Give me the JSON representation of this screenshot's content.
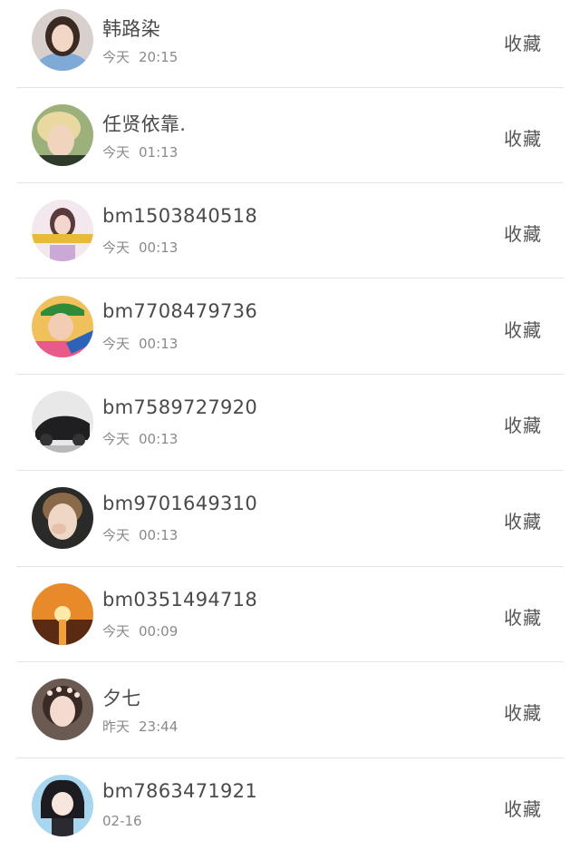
{
  "contacts": [
    {
      "name": "韩路染",
      "day": "今天",
      "time": "20:15",
      "action": "收藏",
      "avatar": "avatar-girl-blue-top"
    },
    {
      "name": "任贤依靠.",
      "day": "今天",
      "time": "01:13",
      "action": "收藏",
      "avatar": "avatar-blonde-boy"
    },
    {
      "name": "bm1503840518",
      "day": "今天",
      "time": "00:13",
      "action": "收藏",
      "avatar": "avatar-girl-banner"
    },
    {
      "name": "bm7708479736",
      "day": "今天",
      "time": "00:13",
      "action": "收藏",
      "avatar": "avatar-boy-green-cap"
    },
    {
      "name": "bm7589727920",
      "day": "今天",
      "time": "00:13",
      "action": "收藏",
      "avatar": "avatar-black-car"
    },
    {
      "name": "bm9701649310",
      "day": "今天",
      "time": "00:13",
      "action": "收藏",
      "avatar": "avatar-kid-hand-mouth"
    },
    {
      "name": "bm0351494718",
      "day": "今天",
      "time": "00:09",
      "action": "收藏",
      "avatar": "avatar-sunset-sea"
    },
    {
      "name": "夕七",
      "day": "昨天",
      "time": "23:44",
      "action": "收藏",
      "avatar": "avatar-girl-flower-crown"
    },
    {
      "name": "bm7863471921",
      "day": "",
      "time": "02-16",
      "action": "收藏",
      "avatar": "avatar-anime-girl"
    }
  ]
}
